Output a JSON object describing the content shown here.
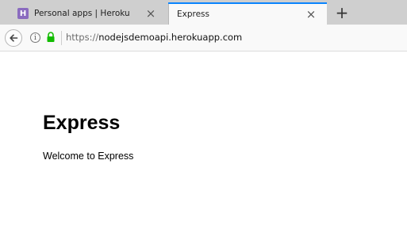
{
  "tabs": [
    {
      "title": "Personal apps | Heroku",
      "favicon": "heroku-icon",
      "active": false
    },
    {
      "title": "Express",
      "favicon": "none",
      "active": true
    }
  ],
  "tab_controls": {
    "close_symbol": "×",
    "new_tab_symbol": "+"
  },
  "navbar": {
    "url_scheme": "https://",
    "url_host": "nodejsdemoapi.herokuapp.com",
    "info_symbol": "i",
    "heroku_favicon_letter": "H"
  },
  "content": {
    "heading": "Express",
    "paragraph": "Welcome to Express"
  },
  "colors": {
    "tab_strip": "#cfcfcf",
    "active_tab_accent": "#0a84ff",
    "lock_green": "#12bc00",
    "heroku_purple": "#8a6bbf"
  }
}
